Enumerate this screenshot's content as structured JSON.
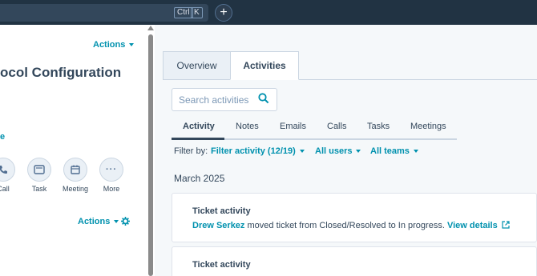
{
  "topbar": {
    "kbd_ctrl": "Ctrl",
    "kbd_k": "K",
    "plus_label": "+"
  },
  "left": {
    "actions_label": "Actions",
    "record_title": "ocol Configuration",
    "small_link": "e",
    "activity_buttons": [
      {
        "label": "Call",
        "icon": "phone-icon"
      },
      {
        "label": "Task",
        "icon": "task-icon"
      },
      {
        "label": "Meeting",
        "icon": "calendar-icon"
      },
      {
        "label": "More",
        "icon": "more-icon"
      }
    ],
    "actions_bottom_label": "Actions"
  },
  "right": {
    "tabs": [
      "Overview",
      "Activities"
    ],
    "search_placeholder": "Search activities",
    "subtabs": [
      "Activity",
      "Notes",
      "Emails",
      "Calls",
      "Tasks",
      "Meetings"
    ],
    "filter_label": "Filter by:",
    "filters": [
      "Filter activity (12/19)",
      "All users",
      "All teams"
    ],
    "month": "March 2025",
    "cards": [
      {
        "title": "Ticket activity",
        "actor": "Drew Serkez",
        "body": " moved ticket from Closed/Resolved to In progress. ",
        "link": "View details"
      },
      {
        "title": "Ticket activity"
      }
    ]
  },
  "colors": {
    "topbar": "#213343",
    "accent": "#0091ae",
    "text": "#33475b"
  }
}
